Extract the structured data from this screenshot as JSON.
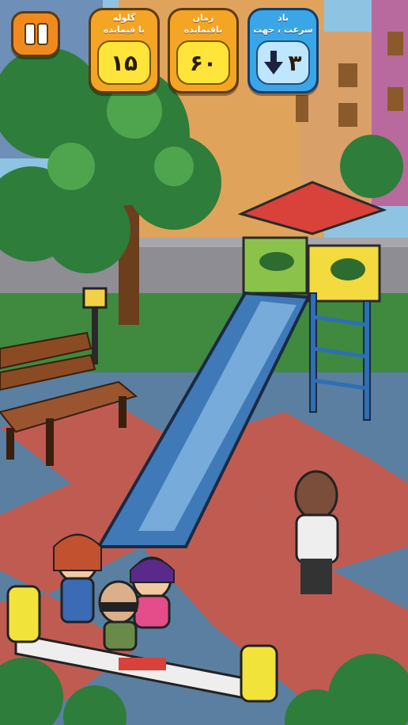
{
  "hud": {
    "bullets": {
      "label_line1": "گلوله",
      "label_line2": "با قیمانده",
      "value": "۱۵"
    },
    "time": {
      "label_line1": "زمان",
      "label_line2": "باقیمانده",
      "value": "۶۰"
    },
    "wind": {
      "label_line1": "باد",
      "label_line2": "سرعت ، جهت",
      "value": "۳",
      "direction": "down",
      "arrow_icon": "arrow-down-icon"
    }
  },
  "pause_button": {
    "icon": "pause-icon"
  },
  "colors": {
    "hud_orange": "#f5a524",
    "hud_blue": "#3aa6e8",
    "value_yellow": "#ffe43a",
    "pause_orange": "#f08a1e"
  }
}
